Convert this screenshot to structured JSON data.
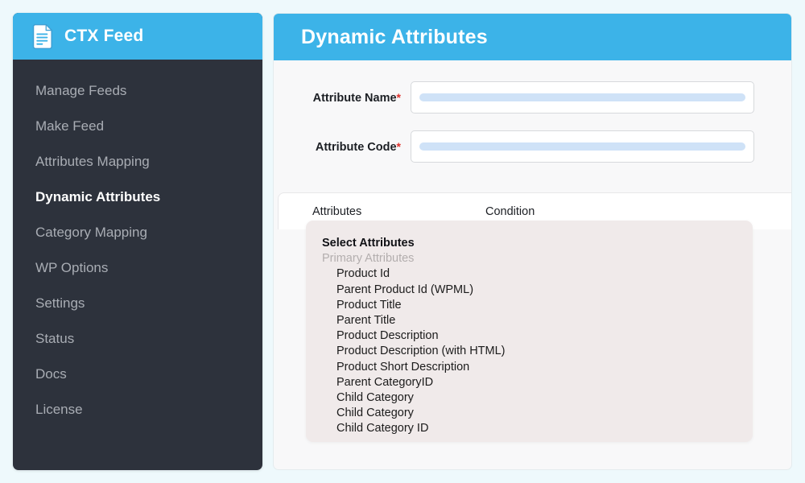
{
  "sidebar": {
    "brand": "CTX Feed",
    "logo_icon": "document-lines-icon",
    "header_bg": "#3cb3e8",
    "bg": "#2d323c",
    "items": [
      {
        "label": "Manage Feeds",
        "active": false
      },
      {
        "label": "Make Feed",
        "active": false
      },
      {
        "label": "Attributes Mapping",
        "active": false
      },
      {
        "label": "Dynamic Attributes",
        "active": true
      },
      {
        "label": "Category Mapping",
        "active": false
      },
      {
        "label": "WP Options",
        "active": false
      },
      {
        "label": "Settings",
        "active": false
      },
      {
        "label": "Status",
        "active": false
      },
      {
        "label": "Docs",
        "active": false
      },
      {
        "label": "License",
        "active": false
      }
    ]
  },
  "main": {
    "title": "Dynamic Attributes",
    "header_bg": "#3cb3e8",
    "form": {
      "required_marker": "*",
      "fields": [
        {
          "label": "Attribute Name",
          "required": true,
          "value": "",
          "placeholder": ""
        },
        {
          "label": "Attribute Code",
          "required": true,
          "value": "",
          "placeholder": ""
        }
      ]
    },
    "table": {
      "columns": [
        "Attributes",
        "Condition"
      ]
    }
  },
  "dropdown": {
    "bg": "#f0eaea",
    "title": "Select Attributes",
    "group_label": "Primary Attributes",
    "options": [
      "Product Id",
      "Parent Product Id (WPML)",
      "Product Title",
      "Parent Title",
      "Product Description",
      "Product Description (with HTML)",
      "Product Short Description",
      "Parent CategoryID",
      "Child Category",
      "Child Category",
      "Child Category ID"
    ]
  },
  "colors": {
    "accent": "#3cb3e8",
    "sidebar": "#2d323c",
    "page_bg": "#eef9fc",
    "required": "#e0322e",
    "skeleton": "#cfe2f7"
  }
}
